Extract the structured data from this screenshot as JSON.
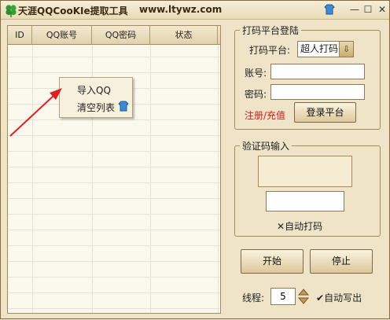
{
  "window": {
    "title": "天涯QQCooKIe提取工具",
    "url": "www.ltywz.com"
  },
  "list": {
    "columns": [
      "ID",
      "QQ账号",
      "QQ密码",
      "状态"
    ]
  },
  "context_menu": {
    "items": [
      "导入QQ",
      "清空列表"
    ]
  },
  "login_group": {
    "title": "打码平台登陆",
    "platform_label": "打码平台:",
    "platform_selected": "超人打码",
    "account_label": "账号:",
    "account_value": "",
    "password_label": "密码:",
    "password_value": "",
    "register_link": "注册/充值",
    "login_button": "登录平台"
  },
  "captcha_group": {
    "title": "验证码输入",
    "captcha_value": "",
    "auto_code_mark": "✕",
    "auto_code_label": "自动打码"
  },
  "controls": {
    "start_button": "开始",
    "stop_button": "停止",
    "threads_label": "线程:",
    "threads_value": "5",
    "auto_write_mark": "✔",
    "auto_write_label": "自动写出"
  },
  "colors": {
    "accent_red": "#d01c1c",
    "arrow_red": "#e02020",
    "window_bg": "#efe4c8"
  }
}
